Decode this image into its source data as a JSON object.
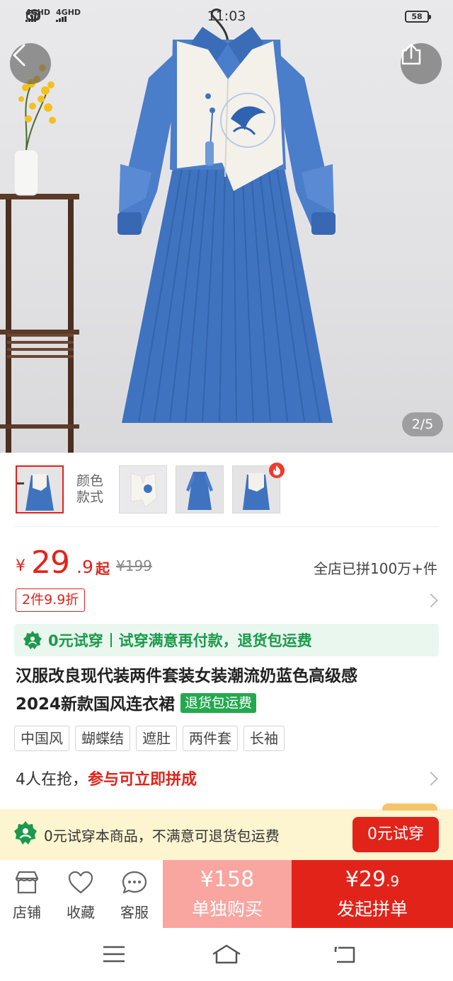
{
  "status_bar": {
    "network1": "4GHD",
    "network2": "4GHD",
    "time": "11:03",
    "battery": "58"
  },
  "gallery": {
    "page_indicator": "2/5",
    "back_icon": "chevron-left-icon",
    "share_icon": "share-icon"
  },
  "variants": {
    "label_line1": "颜色",
    "label_line2": "款式",
    "hot_icon": "fire-icon"
  },
  "price": {
    "currency": "¥",
    "integer": "29",
    "decimal": ".9",
    "suffix": "起",
    "original": "¥199",
    "sold_text": "全店已拼100万+件"
  },
  "discount_tag": "2件9.9折",
  "trial_banner": {
    "icon": "gift-badge-icon",
    "part1": "0元试穿",
    "part2": "试穿满意再付款，退货包运费"
  },
  "title": {
    "line1": "汉服改良现代装两件套装女装潮流奶蓝色高级感",
    "line2": "2024新款国风连衣裙",
    "badge": "退货包运费"
  },
  "tags": [
    "中国风",
    "蝴蝶结",
    "遮肚",
    "两件套",
    "长袖"
  ],
  "group_buy": {
    "prefix": "4人在抢，",
    "link": "参与可立即拼成"
  },
  "trial_bar": {
    "text": "0元试穿本商品，不满意可退货包运费",
    "button": "0元试穿"
  },
  "actions": {
    "store": "店铺",
    "favorite": "收藏",
    "service": "客服",
    "alone_price_main": "¥158",
    "alone_label": "单独购买",
    "group_price_main": "¥29",
    "group_price_dec": ".9",
    "group_label": "发起拼单"
  },
  "colors": {
    "accent_red": "#e2231a",
    "light_red": "#f9a5a0",
    "green": "#1a9a4a",
    "dress_blue": "#3f73c0"
  }
}
